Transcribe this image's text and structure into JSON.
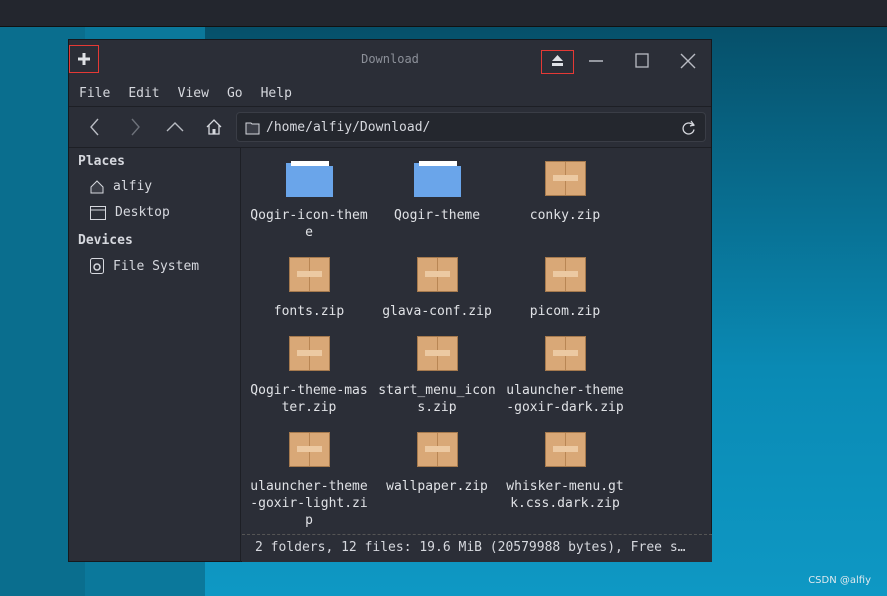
{
  "window": {
    "title": "Download"
  },
  "menu": [
    "File",
    "Edit",
    "View",
    "Go",
    "Help"
  ],
  "location": {
    "path": "/home/alfiy/Download/"
  },
  "sidebar": {
    "places_header": "Places",
    "places": [
      {
        "label": "alfiy",
        "icon": "home-icon"
      },
      {
        "label": "Desktop",
        "icon": "desktop-icon"
      }
    ],
    "devices_header": "Devices",
    "devices": [
      {
        "label": "File System",
        "icon": "drive-icon"
      }
    ]
  },
  "files": [
    {
      "name": "Qogir-icon-theme",
      "type": "folder"
    },
    {
      "name": "Qogir-theme",
      "type": "folder"
    },
    {
      "name": "conky.zip",
      "type": "zip"
    },
    {
      "name": "fonts.zip",
      "type": "zip"
    },
    {
      "name": "glava-conf.zip",
      "type": "zip"
    },
    {
      "name": "picom.zip",
      "type": "zip"
    },
    {
      "name": "Qogir-theme-master.zip",
      "type": "zip"
    },
    {
      "name": "start_menu_icons.zip",
      "type": "zip"
    },
    {
      "name": "ulauncher-theme-goxir-dark.zip",
      "type": "zip"
    },
    {
      "name": "ulauncher-theme-goxir-light.zip",
      "type": "zip"
    },
    {
      "name": "wallpaper.zip",
      "type": "zip"
    },
    {
      "name": "whisker-menu.gtk.css.dark.zip",
      "type": "zip"
    }
  ],
  "status": "2 folders, 12 files: 19.6 MiB (20579988 bytes), Free s…",
  "watermark": "CSDN @alfiy"
}
